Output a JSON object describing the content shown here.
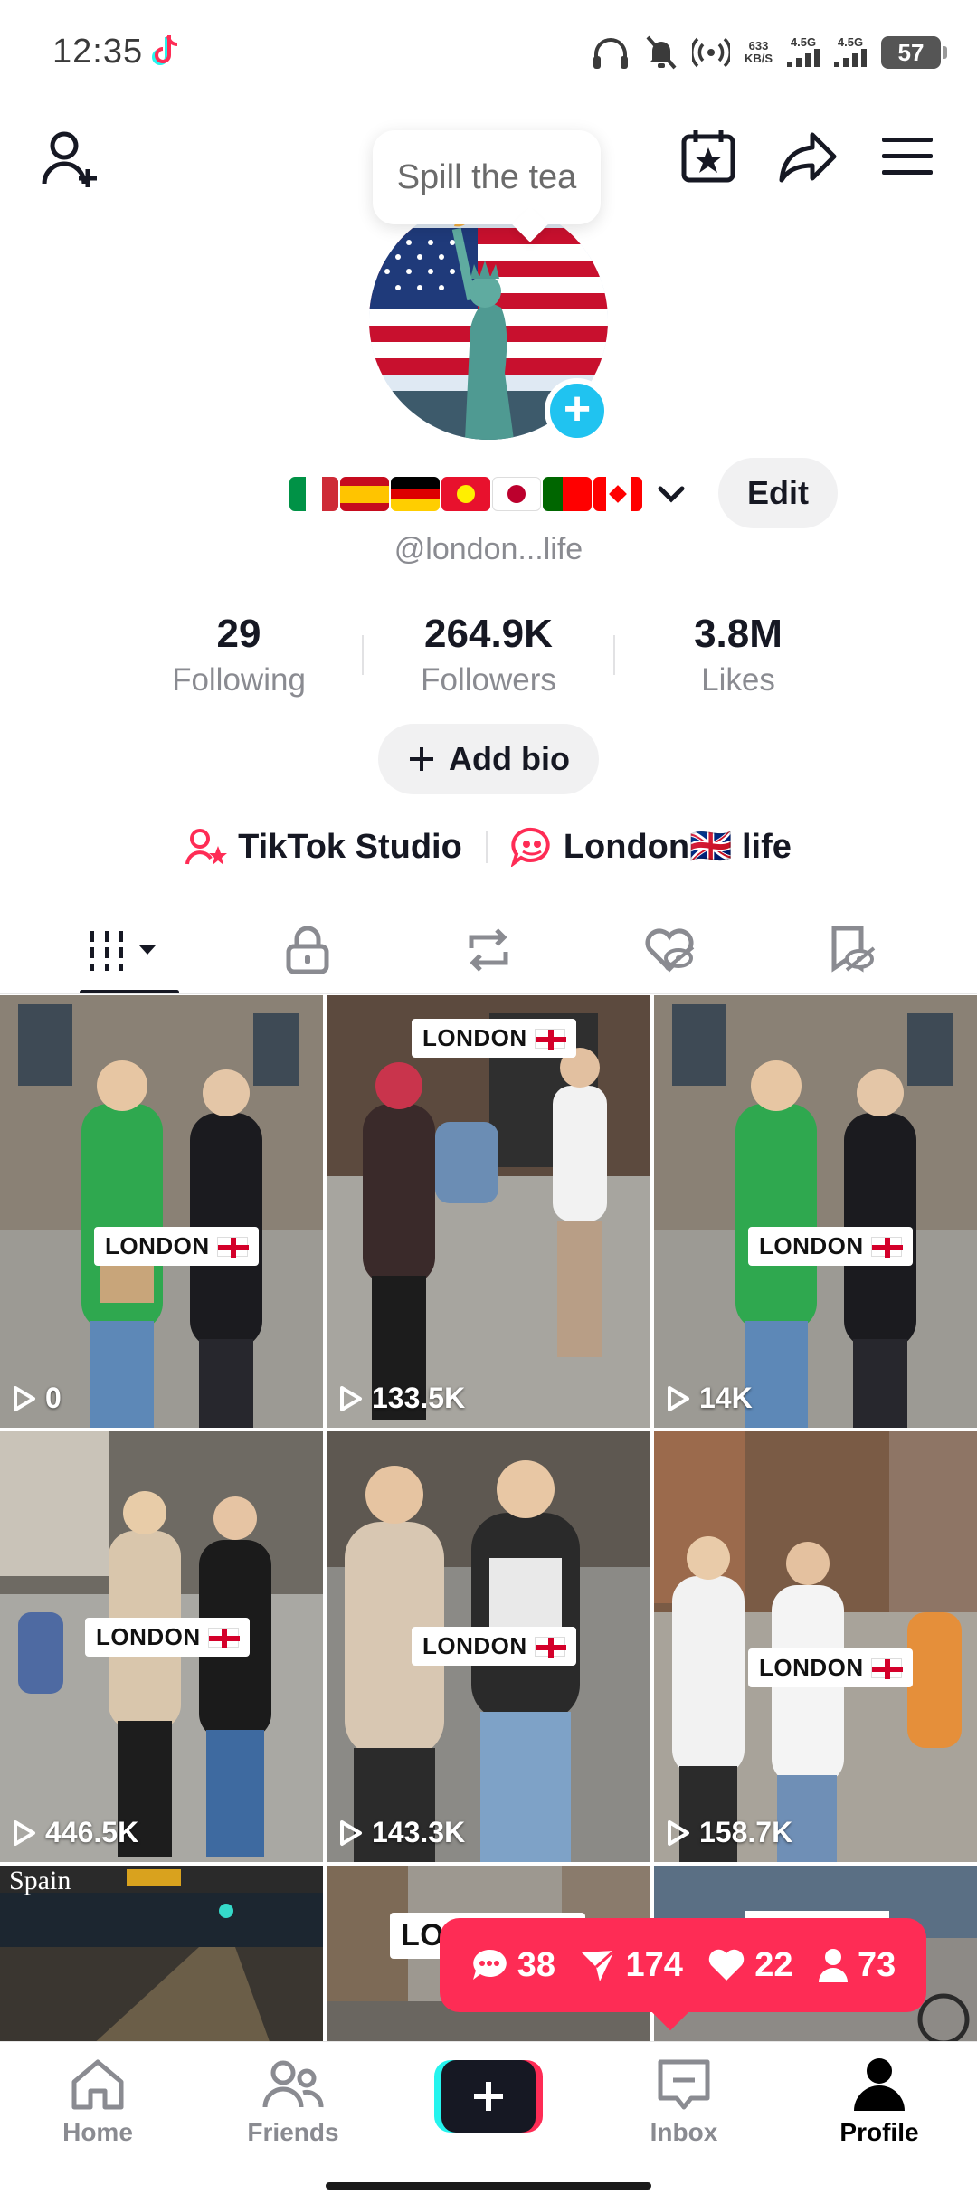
{
  "status_bar": {
    "time": "12:35",
    "net_speed_value": "633",
    "net_speed_unit": "KB/S",
    "signal1": "4.5G",
    "signal2": "4.5G",
    "battery": "57"
  },
  "tooltip": {
    "text": "Spill the tea"
  },
  "profile": {
    "display_flags": [
      "italy",
      "spain",
      "germany",
      "kyrgyzstan",
      "japan",
      "portugal",
      "canada"
    ],
    "edit_label": "Edit",
    "handle": "@london...life",
    "stats": [
      {
        "value": "29",
        "label": "Following"
      },
      {
        "value": "264.9K",
        "label": "Followers"
      },
      {
        "value": "3.8M",
        "label": "Likes"
      }
    ],
    "add_bio_label": "Add bio",
    "links": [
      {
        "label": "TikTok Studio",
        "icon": "studio-icon"
      },
      {
        "label": "London🇬🇧 life",
        "icon": "group-chat-icon"
      }
    ]
  },
  "tabs": [
    {
      "name": "videos-grid",
      "icon": "grid-icon",
      "active": true
    },
    {
      "name": "private",
      "icon": "lock-icon"
    },
    {
      "name": "reposts",
      "icon": "repost-icon"
    },
    {
      "name": "liked",
      "icon": "heart-hidden-icon"
    },
    {
      "name": "favorites",
      "icon": "bookmark-hidden-icon"
    }
  ],
  "videos": [
    {
      "views": "0",
      "tag": "LONDON"
    },
    {
      "views": "133.5K",
      "tag": "LONDON"
    },
    {
      "views": "14K",
      "tag": "LONDON"
    },
    {
      "views": "446.5K",
      "tag": "LONDON"
    },
    {
      "views": "143.3K",
      "tag": "LONDON"
    },
    {
      "views": "158.7K",
      "tag": "LONDON"
    },
    {
      "views": "",
      "tag": "Spain"
    },
    {
      "views": "",
      "tag": "LONDON"
    },
    {
      "views": "",
      "tag": ""
    }
  ],
  "notification": {
    "comments": "38",
    "shares": "174",
    "likes": "22",
    "followers": "73"
  },
  "bottom_nav": [
    {
      "label": "Home",
      "icon": "home-icon"
    },
    {
      "label": "Friends",
      "icon": "friends-icon"
    },
    {
      "label": "",
      "icon": "create-icon"
    },
    {
      "label": "Inbox",
      "icon": "inbox-icon"
    },
    {
      "label": "Profile",
      "icon": "profile-icon",
      "active": true
    }
  ],
  "colors": {
    "accent": "#fe2c55",
    "cyan": "#20c3f0",
    "text": "#161823",
    "muted": "#8a8b91"
  }
}
